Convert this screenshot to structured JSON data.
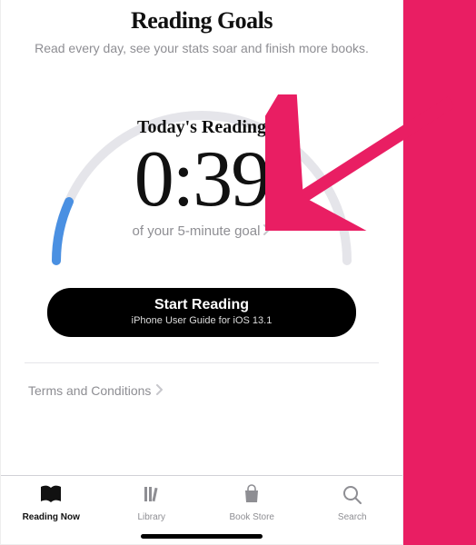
{
  "header": {
    "title": "Reading Goals",
    "subtitle": "Read every day, see your stats soar and finish more books."
  },
  "gauge": {
    "today_label": "Today's Reading",
    "time_display": "0:39",
    "goal_text": "of your 5-minute goal",
    "progress_fraction": 0.13
  },
  "start_button": {
    "main": "Start Reading",
    "sub": "iPhone User Guide for iOS 13.1"
  },
  "footer": {
    "terms_label": "Terms and Conditions"
  },
  "tabs": {
    "reading_now": "Reading Now",
    "library": "Library",
    "book_store": "Book Store",
    "search": "Search",
    "active": "reading_now"
  },
  "annotation": {
    "arrow_color": "#e91e63"
  }
}
